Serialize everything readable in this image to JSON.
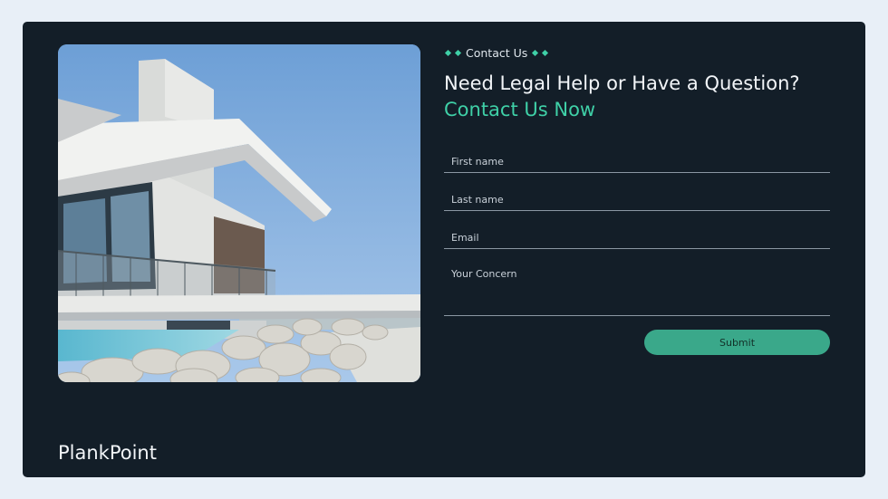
{
  "section": {
    "eyebrow": "Contact Us"
  },
  "heading": {
    "line1": "Need Legal Help or Have a Question?",
    "line2": "Contact Us Now"
  },
  "form": {
    "first_name_placeholder": "First name",
    "last_name_placeholder": "Last name",
    "email_placeholder": "Email",
    "concern_placeholder": "Your Concern",
    "submit_label": "Submit"
  },
  "brand": {
    "name": "PlankPoint"
  },
  "colors": {
    "page_background": "#e8eff7",
    "card_background": "#131e28",
    "accent": "#3fd0a7",
    "button": "#3aa88a"
  },
  "icons": {
    "eyebrow_marks": "diamond-icon"
  }
}
